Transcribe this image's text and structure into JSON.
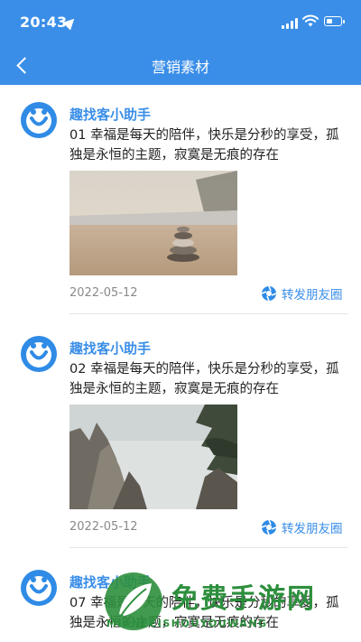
{
  "status": {
    "time": "20:43"
  },
  "nav": {
    "title": "营销素材"
  },
  "posts": [
    {
      "author": "趣找客小助手",
      "text": "01 幸福是每天的陪伴，快乐是分秒的享受，孤独是永恒的主题，寂寞是无痕的存在",
      "date": "2022-05-12",
      "share_label": "转发朋友圈",
      "image": "beach-stones"
    },
    {
      "author": "趣找客小助手",
      "text": "02 幸福是每天的陪伴，快乐是分秒的享受，孤独是永恒的主题，寂寞是无痕的存在",
      "date": "2022-05-12",
      "share_label": "转发朋友圈",
      "image": "mountain-pine"
    },
    {
      "author": "趣找客小助手",
      "text": "07 幸福是每天的陪伴，快乐是分秒的享受，孤独是永恒的主题，寂寞是无痕的存在",
      "date": "",
      "share_label": "",
      "image": ""
    }
  ],
  "watermark": {
    "title": "免费手游网",
    "subtitle": "MIANFEISHOUYOUWANG"
  },
  "colors": {
    "brand": "#3a8ee8",
    "watermark": "#2d8f3d"
  }
}
